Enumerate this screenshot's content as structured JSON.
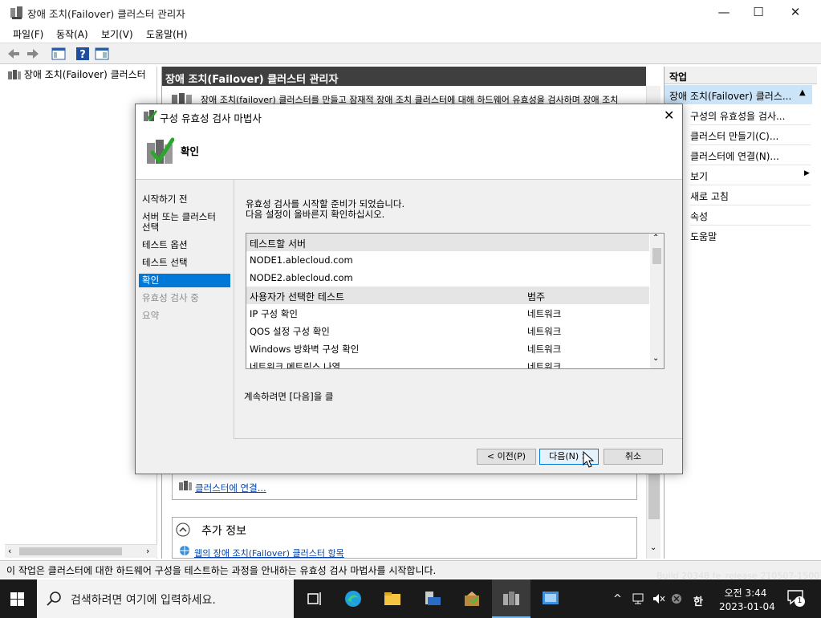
{
  "window": {
    "title": "장애 조치(Failover) 클러스터 관리자"
  },
  "menu": [
    "파일(F)",
    "동작(A)",
    "보기(V)",
    "도움말(H)"
  ],
  "tree": {
    "root": "장애 조치(Failover) 클러스터"
  },
  "center": {
    "header": "장애 조치(Failover) 클러스터 관리자",
    "description": "장애 조치(failover) 클러스터를 만들고 잠재적 장애 조치 클러스터에 대해 하드웨어 유효성을 검사하며 장애 조치",
    "connect_link": "클러스터에 연결...",
    "more_info_title": "추가 정보",
    "web_link": "웹의 장애 조치(Failover) 클러스터 항목"
  },
  "actions": {
    "header": "작업",
    "group": "장애 조치(Failover) 클러스...",
    "items": [
      "구성의 유효성을 검사...",
      "클러스터 만들기(C)...",
      "클러스터에 연결(N)...",
      "보기",
      "새로 고침",
      "속성",
      "도움말"
    ]
  },
  "status": "이 작업은 클러스터에 대한 하드웨어 구성을 테스트하는 과정을 안내하는 유효성 검사 마법사를 시작합니다.",
  "dialog": {
    "title": "구성 유효성 검사 마법사",
    "heading": "확인",
    "nav": [
      {
        "label": "시작하기 전",
        "state": "normal"
      },
      {
        "label": "서버 또는 클러스터 선택",
        "state": "normal"
      },
      {
        "label": "테스트 옵션",
        "state": "normal"
      },
      {
        "label": "테스트 선택",
        "state": "normal"
      },
      {
        "label": "확인",
        "state": "selected"
      },
      {
        "label": "유효성 검사 중",
        "state": "disabled"
      },
      {
        "label": "요약",
        "state": "disabled"
      }
    ],
    "intro_line1": "유효성 검사를 시작할 준비가 되었습니다.",
    "intro_line2": "다음 설정이 올바른지 확인하십시오.",
    "list": {
      "servers_header": "테스트할 서버",
      "servers": [
        "NODE1.ablecloud.com",
        "NODE2.ablecloud.com"
      ],
      "tests_header": "사용자가 선택한 테스트",
      "category_header": "범주",
      "tests": [
        {
          "name": "IP 구성 확인",
          "category": "네트워크"
        },
        {
          "name": "QOS 설정 구성 확인",
          "category": "네트워크"
        },
        {
          "name": "Windows 방화벽 구성 확인",
          "category": "네트워크"
        },
        {
          "name": "네트워크 메트릭스 나열",
          "category": "네트워크"
        }
      ]
    },
    "continue_text": "계속하려면 [다음]을 클",
    "buttons": {
      "back": "< 이전(P)",
      "next": "다음(N) >",
      "cancel": "취소"
    }
  },
  "taskbar": {
    "search_placeholder": "검색하려면 여기에 입력하세요.",
    "time": "오전 3:44",
    "date": "2023-01-04",
    "ime": "한",
    "notification_count": "1"
  },
  "build_text": "Build 20348.fe_release.210507-1500",
  "colors": {
    "selection": "#0078d7",
    "header_dark": "#3f3f3f",
    "desktop": "#1c6ea4"
  }
}
